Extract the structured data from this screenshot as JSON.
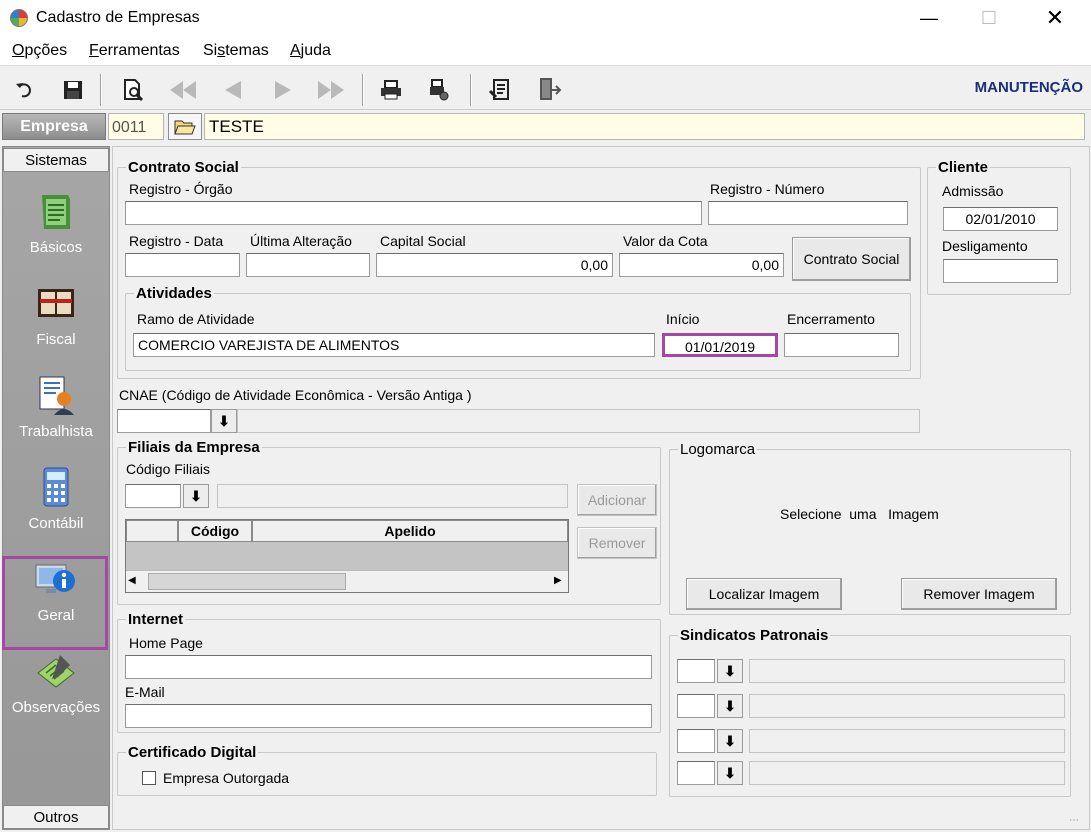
{
  "window": {
    "title": "Cadastro de Empresas"
  },
  "menu": [
    {
      "pre": "",
      "key": "O",
      "post": "pções"
    },
    {
      "pre": "",
      "key": "F",
      "post": "erramentas"
    },
    {
      "pre": "Si",
      "key": "s",
      "post": "temas"
    },
    {
      "pre": "",
      "key": "A",
      "post": "juda"
    }
  ],
  "toolbar": {
    "mode": "MANUTENÇÃO"
  },
  "empresa": {
    "label": "Empresa",
    "code": "0011",
    "name": "TESTE"
  },
  "sidebar": {
    "header": "Sistemas",
    "footer": "Outros",
    "items": [
      {
        "label": "Básicos",
        "icon": "book-icon"
      },
      {
        "label": "Fiscal",
        "icon": "register-book-icon"
      },
      {
        "label": "Trabalhista",
        "icon": "worker-document-icon"
      },
      {
        "label": "Contábil",
        "icon": "calculator-icon"
      },
      {
        "label": "Geral",
        "icon": "info-icon"
      },
      {
        "label": "Observações",
        "icon": "notepad-pen-icon"
      }
    ]
  },
  "contrato": {
    "legend": "Contrato Social",
    "registro_orgao_label": "Registro - Órgão",
    "registro_orgao": "",
    "registro_numero_label": "Registro - Número",
    "registro_numero": "",
    "registro_data_label": "Registro - Data",
    "registro_data": "",
    "ultima_alteracao_label": "Última Alteração",
    "ultima_alteracao": "",
    "capital_label": "Capital Social",
    "capital": "0,00",
    "valor_cota_label": "Valor da Cota",
    "valor_cota": "0,00",
    "button": "Contrato Social"
  },
  "atividades": {
    "legend": "Atividades",
    "ramo_label": "Ramo de Atividade",
    "ramo": "COMERCIO VAREJISTA DE ALIMENTOS",
    "inicio_label": "Início",
    "inicio": "01/01/2019",
    "encerramento_label": "Encerramento",
    "encerramento": ""
  },
  "cliente": {
    "legend": "Cliente",
    "admissao_label": "Admissão",
    "admissao": "02/01/2010",
    "desligamento_label": "Desligamento",
    "desligamento": ""
  },
  "cnae": {
    "label": "CNAE (Código de Atividade Econômica - Versão Antiga )",
    "value": ""
  },
  "filiais": {
    "legend": "Filiais da Empresa",
    "codigo_label": "Código Filiais",
    "add_button": "Adicionar",
    "remove_button": "Remover",
    "columns": [
      "",
      "Código",
      "Apelido"
    ]
  },
  "logomarca": {
    "legend": "Logomarca",
    "placeholder": "Selecione  uma   Imagem",
    "locate_button": "Localizar Imagem",
    "remove_button": "Remover Imagem"
  },
  "internet": {
    "legend": "Internet",
    "homepage_label": "Home Page",
    "homepage": "",
    "email_label": "E-Mail",
    "email": ""
  },
  "sindicatos": {
    "legend": "Sindicatos Patronais"
  },
  "certificado": {
    "legend": "Certificado Digital",
    "outorgada_label": "Empresa Outorgada",
    "outorgada_checked": false
  },
  "colors": {
    "highlight": "#a349a4",
    "empresa_bg": "#fffde6",
    "mode_label": "#1a2f7a"
  }
}
